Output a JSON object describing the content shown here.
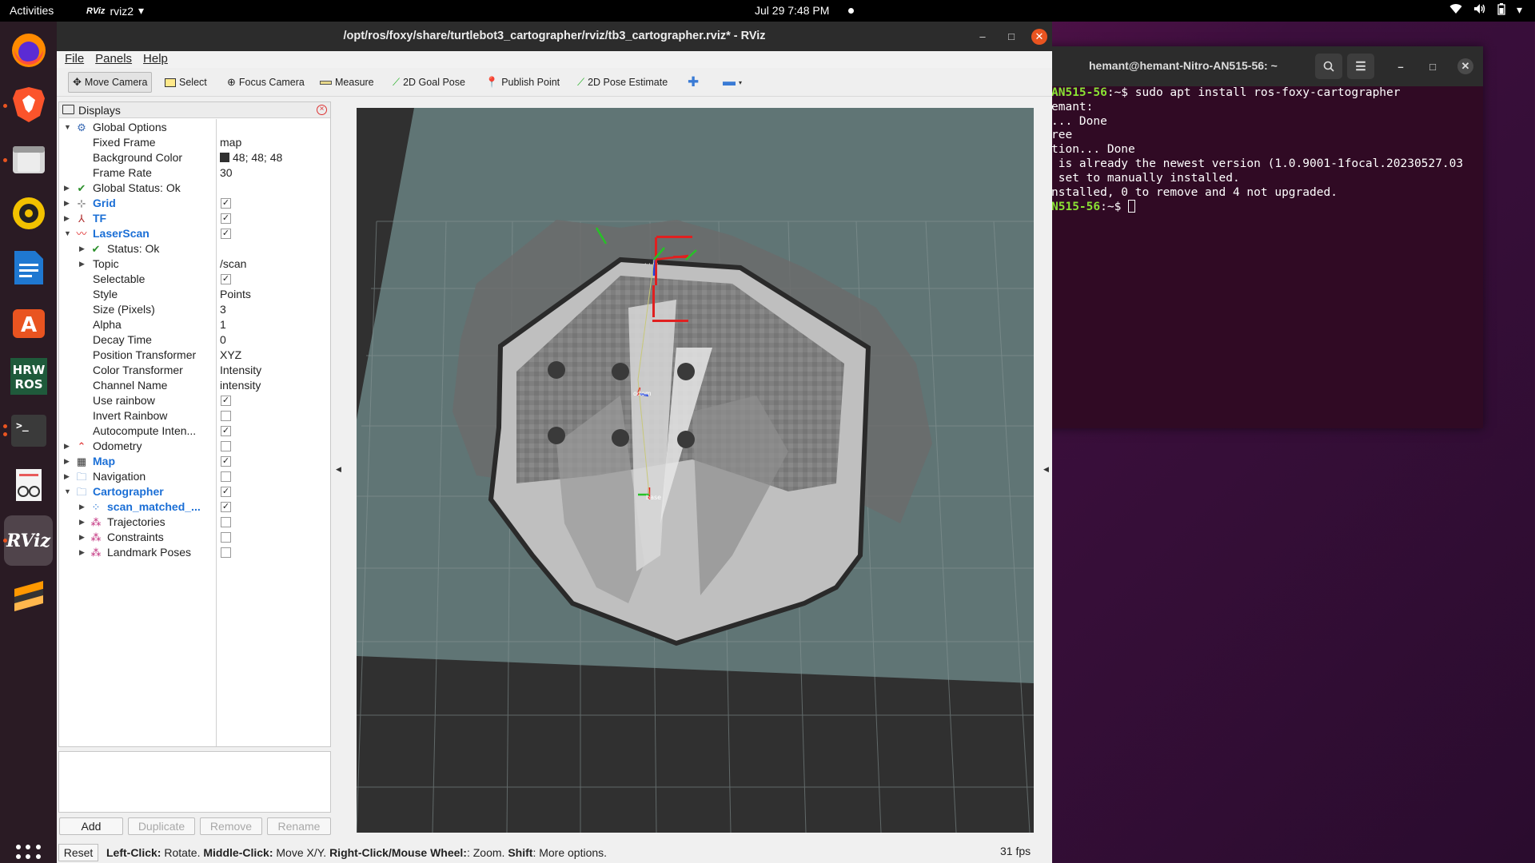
{
  "topbar": {
    "activities": "Activities",
    "app_icon_text": "RViz",
    "app_name": "rviz2",
    "clock": "Jul 29  7:48 PM"
  },
  "terminal": {
    "title": "hemant@hemant-Nitro-AN515-56: ~",
    "lines": [
      {
        "prompt": "AN515-56",
        "rest": ":~$ sudo apt install ros-foxy-cartographer"
      },
      {
        "prompt": "",
        "rest": "emant:"
      },
      {
        "prompt": "",
        "rest": "... Done"
      },
      {
        "prompt": "",
        "rest": "ree"
      },
      {
        "prompt": "",
        "rest": "tion... Done"
      },
      {
        "prompt": "",
        "rest": " is already the newest version (1.0.9001-1focal.20230527.03"
      },
      {
        "prompt": "",
        "rest": ""
      },
      {
        "prompt": "",
        "rest": " set to manually installed."
      },
      {
        "prompt": "",
        "rest": "nstalled, 0 to remove and 4 not upgraded."
      },
      {
        "prompt": "N515-56",
        "rest": ":~$ "
      }
    ]
  },
  "rviz": {
    "title": "/opt/ros/foxy/share/turtlebot3_cartographer/rviz/tb3_cartographer.rviz* - RViz",
    "menu": [
      "File",
      "Panels",
      "Help"
    ],
    "toolbar": {
      "move_camera": "Move Camera",
      "select": "Select",
      "focus_camera": "Focus Camera",
      "measure": "Measure",
      "goal_pose": "2D Goal Pose",
      "publish_point": "Publish Point",
      "pose_estimate": "2D Pose Estimate"
    },
    "displays_title": "Displays",
    "tree": {
      "global_options": "Global Options",
      "fixed_frame": {
        "label": "Fixed Frame",
        "value": "map"
      },
      "background_color": {
        "label": "Background Color",
        "value": "48; 48; 48",
        "color": "#303030"
      },
      "frame_rate": {
        "label": "Frame Rate",
        "value": "30"
      },
      "global_status": "Global Status: Ok",
      "grid": "Grid",
      "tf": "TF",
      "laserscan": "LaserScan",
      "status_ok": "Status: Ok",
      "topic": {
        "label": "Topic",
        "value": "/scan"
      },
      "selectable": "Selectable",
      "style": {
        "label": "Style",
        "value": "Points"
      },
      "size": {
        "label": "Size (Pixels)",
        "value": "3"
      },
      "alpha": {
        "label": "Alpha",
        "value": "1"
      },
      "decay": {
        "label": "Decay Time",
        "value": "0"
      },
      "position_transformer": {
        "label": "Position Transformer",
        "value": "XYZ"
      },
      "color_transformer": {
        "label": "Color Transformer",
        "value": "Intensity"
      },
      "channel_name": {
        "label": "Channel Name",
        "value": "intensity"
      },
      "use_rainbow": "Use rainbow",
      "invert_rainbow": "Invert Rainbow",
      "autocompute": "Autocompute Inten...",
      "odometry": "Odometry",
      "map": "Map",
      "navigation": "Navigation",
      "cartographer": "Cartographer",
      "scan_matched": "scan_matched_...",
      "trajectories": "Trajectories",
      "constraints": "Constraints",
      "landmark_poses": "Landmark Poses"
    },
    "buttons": {
      "add": "Add",
      "duplicate": "Duplicate",
      "remove": "Remove",
      "rename": "Rename"
    },
    "status": {
      "reset": "Reset",
      "left_click_key": "Left-Click:",
      "left_click_val": " Rotate. ",
      "middle_click_key": "Middle-Click:",
      "middle_click_val": " Move X/Y. ",
      "right_click_key": "Right-Click/Mouse Wheel:",
      "right_click_val": ": Zoom. ",
      "shift_key": "Shift",
      "shift_val": ": More options.",
      "fps": "31 fps"
    },
    "view_labels": {
      "base": "base",
      "odom": "odom"
    }
  }
}
